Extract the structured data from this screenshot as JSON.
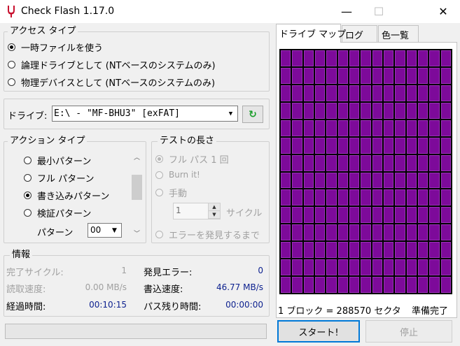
{
  "window": {
    "title": "Check Flash 1.17.0",
    "minimize": "—",
    "maximize": "☐",
    "close": "✕"
  },
  "access_type": {
    "label": "アクセス タイプ",
    "options": [
      {
        "label": "一時ファイルを使う",
        "selected": true
      },
      {
        "label": "論理ドライブとして (NTベースのシステムのみ)",
        "selected": false
      },
      {
        "label": "物理デバイスとして (NTベースのシステムのみ)",
        "selected": false
      }
    ]
  },
  "drive": {
    "label": "ドライブ:",
    "value": "E:\\ - \"MF-BHU3\" [exFAT]",
    "refresh_icon": "↻"
  },
  "action_type": {
    "label": "アクション タイプ",
    "options": [
      {
        "label": "最小パターン",
        "selected": false
      },
      {
        "label": "フル パターン",
        "selected": false
      },
      {
        "label": "書き込みパターン",
        "selected": true
      },
      {
        "label": "検証パターン",
        "selected": false
      }
    ],
    "pattern_label": "パターン",
    "pattern_value": "00"
  },
  "test_length": {
    "label": "テストの長さ",
    "options": [
      {
        "label": "フル パス 1 回",
        "selected": true
      },
      {
        "label": "Burn it!",
        "selected": false
      },
      {
        "label": "手動",
        "selected": false
      },
      {
        "label": "エラーを発見するまで",
        "selected": false
      }
    ],
    "cycle_value": "1",
    "cycle_label": "サイクル"
  },
  "info": {
    "label": "情報",
    "completed_cycles_label": "完了サイクル:",
    "completed_cycles": "1",
    "read_speed_label": "読取速度:",
    "read_speed": "0.00 MB/s",
    "elapsed_label": "経過時間:",
    "elapsed": "00:10:15",
    "errors_label": "発見エラー:",
    "errors": "0",
    "write_speed_label": "書込速度:",
    "write_speed": "46.77 MB/s",
    "pass_remaining_label": "パス残り時間:",
    "pass_remaining": "00:00:00"
  },
  "tabs": [
    {
      "label": "ドライブ マップ",
      "active": true
    },
    {
      "label": "ログ",
      "active": false
    },
    {
      "label": "色一覧",
      "active": false
    }
  ],
  "map": {
    "cell_color": "#7d0a9a",
    "block_info": "1 ブロック = 288570 セクタ",
    "status": "準備完了"
  },
  "buttons": {
    "start": "スタート!",
    "stop": "停止"
  },
  "colors": {
    "accent": "#0078d7",
    "info_value": "#0b1f8e",
    "refresh": "#1a9e2a"
  }
}
